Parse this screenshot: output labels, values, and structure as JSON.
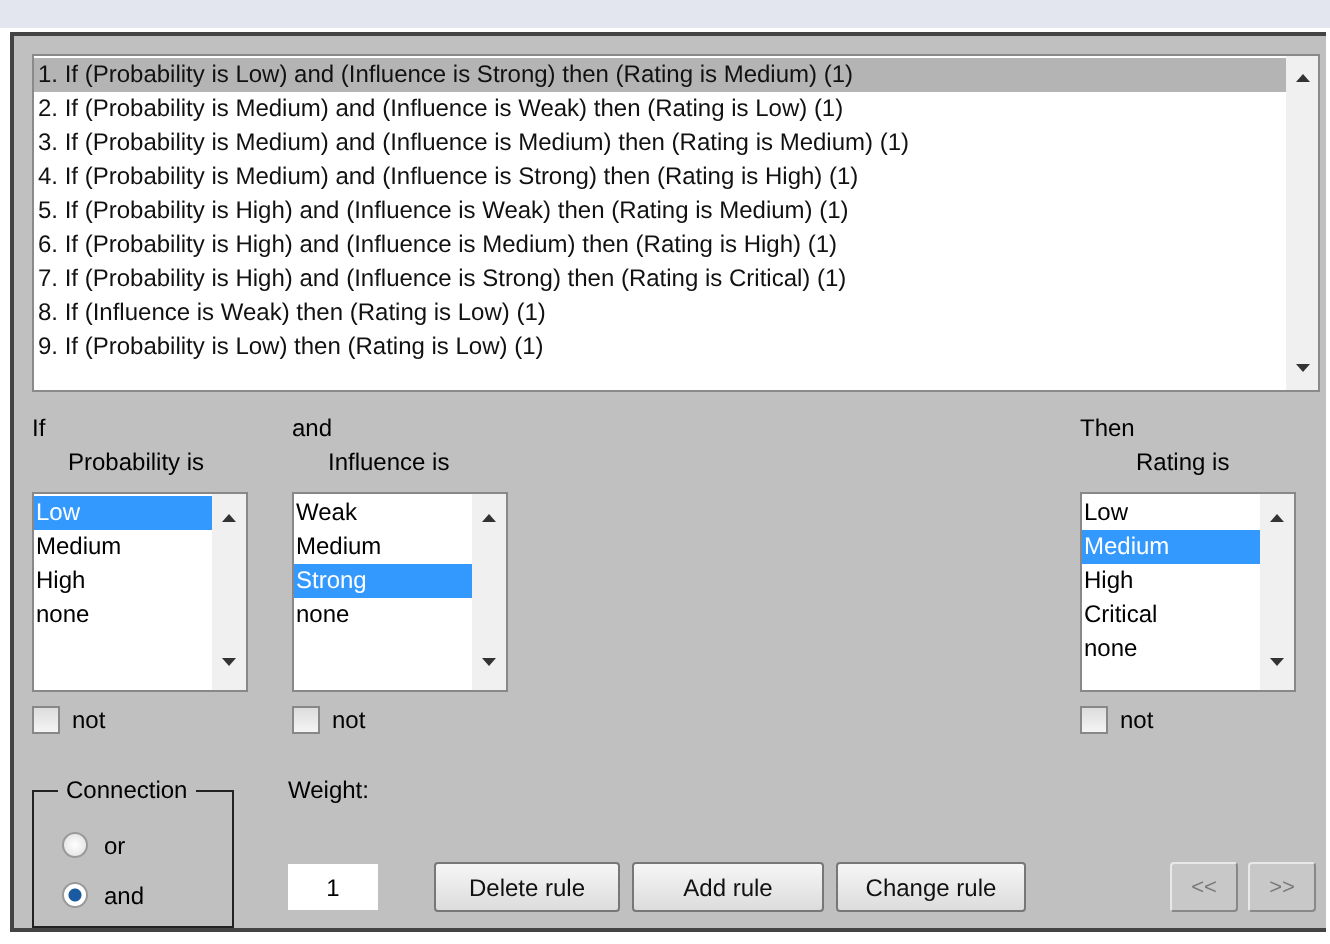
{
  "rules": [
    {
      "text": "1. If (Probability is Low) and (Influence is Strong) then (Rating is Medium) (1)",
      "selected": true
    },
    {
      "text": "2. If (Probability is Medium) and (Influence is Weak) then (Rating is Low) (1)",
      "selected": false
    },
    {
      "text": "3. If (Probability is Medium) and (Influence is Medium) then (Rating is Medium) (1)",
      "selected": false
    },
    {
      "text": "4. If (Probability is Medium) and (Influence is Strong) then (Rating is High) (1)",
      "selected": false
    },
    {
      "text": "5. If (Probability is High) and (Influence is Weak) then (Rating is Medium) (1)",
      "selected": false
    },
    {
      "text": "6. If (Probability is High) and (Influence is Medium) then (Rating is High) (1)",
      "selected": false
    },
    {
      "text": "7. If (Probability is High) and (Influence is Strong) then (Rating is Critical) (1)",
      "selected": false
    },
    {
      "text": "8. If (Influence is Weak) then (Rating is Low) (1)",
      "selected": false
    },
    {
      "text": "9. If (Probability is Low) then (Rating is Low) (1)",
      "selected": false
    }
  ],
  "variables": [
    {
      "header": "If",
      "label": "Probability is",
      "not_label": "not",
      "not_checked": false,
      "options": [
        {
          "text": "Low",
          "selected": true
        },
        {
          "text": "Medium",
          "selected": false
        },
        {
          "text": "High",
          "selected": false
        },
        {
          "text": "none",
          "selected": false
        }
      ]
    },
    {
      "header": "and",
      "label": "Influence is",
      "not_label": "not",
      "not_checked": false,
      "options": [
        {
          "text": "Weak",
          "selected": false
        },
        {
          "text": "Medium",
          "selected": false
        },
        {
          "text": "Strong",
          "selected": true
        },
        {
          "text": "none",
          "selected": false
        }
      ]
    },
    {
      "header": "Then",
      "label": "Rating is",
      "not_label": "not",
      "not_checked": false,
      "options": [
        {
          "text": "Low",
          "selected": false
        },
        {
          "text": "Medium",
          "selected": true
        },
        {
          "text": "High",
          "selected": false
        },
        {
          "text": "Critical",
          "selected": false
        },
        {
          "text": "none",
          "selected": false
        }
      ]
    }
  ],
  "connection": {
    "title": "Connection",
    "options": [
      {
        "label": "or",
        "selected": false
      },
      {
        "label": "and",
        "selected": true
      }
    ]
  },
  "weight": {
    "label": "Weight:",
    "value": "1"
  },
  "buttons": [
    {
      "label": "Delete rule",
      "disabled": false
    },
    {
      "label": "Add rule",
      "disabled": false
    },
    {
      "label": "Change rule",
      "disabled": false
    }
  ],
  "nav_buttons": [
    {
      "label": "<<",
      "disabled": true
    },
    {
      "label": ">>",
      "disabled": true
    }
  ]
}
